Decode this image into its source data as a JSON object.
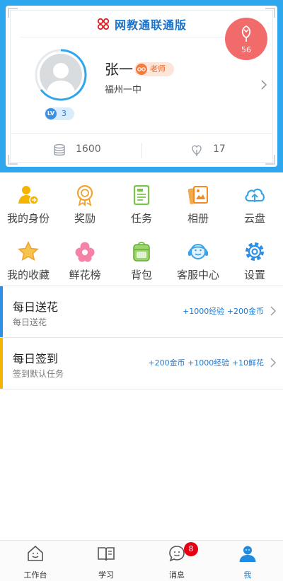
{
  "header": {
    "brand_title": "网教通联通版",
    "flowers_received": "56"
  },
  "profile": {
    "name": "张一",
    "role": "老师",
    "school": "福州一中",
    "level_prefix": "LV",
    "level": "3",
    "coins": "1600",
    "flowers": "17"
  },
  "grid": [
    {
      "label": "我的身份",
      "icon": "identity-icon"
    },
    {
      "label": "奖励",
      "icon": "medal-icon"
    },
    {
      "label": "任务",
      "icon": "task-list-icon"
    },
    {
      "label": "相册",
      "icon": "photo-album-icon"
    },
    {
      "label": "云盘",
      "icon": "cloud-upload-icon"
    },
    {
      "label": "我的收藏",
      "icon": "star-icon"
    },
    {
      "label": "鲜花榜",
      "icon": "flower-icon"
    },
    {
      "label": "背包",
      "icon": "backpack-icon"
    },
    {
      "label": "客服中心",
      "icon": "headset-icon"
    },
    {
      "label": "设置",
      "icon": "gear-icon"
    }
  ],
  "tasks": [
    {
      "title": "每日送花",
      "subtitle": "每日送花",
      "reward": "+1000经验 +200金币",
      "accent": "#2e8fe6"
    },
    {
      "title": "每日签到",
      "subtitle": "签到默认任务",
      "reward": "+200金币 +1000经验 +10鲜花",
      "accent": "#f5b400"
    }
  ],
  "tabbar": {
    "items": [
      {
        "label": "工作台",
        "icon": "home-icon"
      },
      {
        "label": "学习",
        "icon": "book-icon"
      },
      {
        "label": "消息",
        "icon": "chat-icon"
      },
      {
        "label": "我",
        "icon": "user-icon"
      }
    ],
    "message_badge": "8",
    "active": "我"
  },
  "colors": {
    "header_bg": "#2ea7ef",
    "brand": "#1c74c9",
    "flower_badge": "#f26b6b",
    "active_tab": "#1f8be0"
  }
}
